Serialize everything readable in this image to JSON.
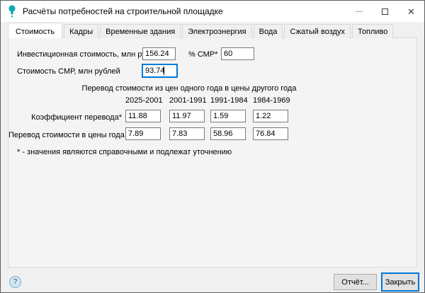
{
  "window": {
    "title": "Расчёты потребностей на строительной площадке",
    "controls": {
      "minimize": "minimize",
      "maximize": "maximize",
      "close_glyph": "✕"
    }
  },
  "tabs": [
    {
      "label": "Стоимость",
      "active": true
    },
    {
      "label": "Кадры",
      "active": false
    },
    {
      "label": "Временные здания",
      "active": false
    },
    {
      "label": "Электроэнергия",
      "active": false
    },
    {
      "label": "Вода",
      "active": false
    },
    {
      "label": "Сжатый воздух",
      "active": false
    },
    {
      "label": "Топливо",
      "active": false
    }
  ],
  "form": {
    "investment_label": "Инвестиционная стоимость, млн рублей",
    "investment_value": "156.24",
    "smr_percent_label": "% СМР*",
    "smr_percent_value": "60",
    "smr_cost_label": "Стоимость СМР, млн рублей",
    "smr_cost_value": "93.74"
  },
  "conversion": {
    "title": "Перевод стоимости из цен одного года в цены другого года",
    "periods": [
      "2025-2001",
      "2001-1991",
      "1991-1984",
      "1984-1969"
    ],
    "rows": [
      {
        "label": "Коэффициент перевода*",
        "values": [
          "11.88",
          "11.97",
          "1.59",
          "1.22"
        ]
      },
      {
        "label": "Перевод стоимости в цены года",
        "values": [
          "7.89",
          "7.83",
          "58.96",
          "76.84"
        ]
      }
    ]
  },
  "footnote": "* - значения являются справочными и подлежат уточнению",
  "footer": {
    "help_glyph": "?",
    "report_button": "Отчёт...",
    "close_button": "Закрыть"
  },
  "colors": {
    "accent": "#0078d7",
    "icon_teal": "#12a5b2"
  }
}
